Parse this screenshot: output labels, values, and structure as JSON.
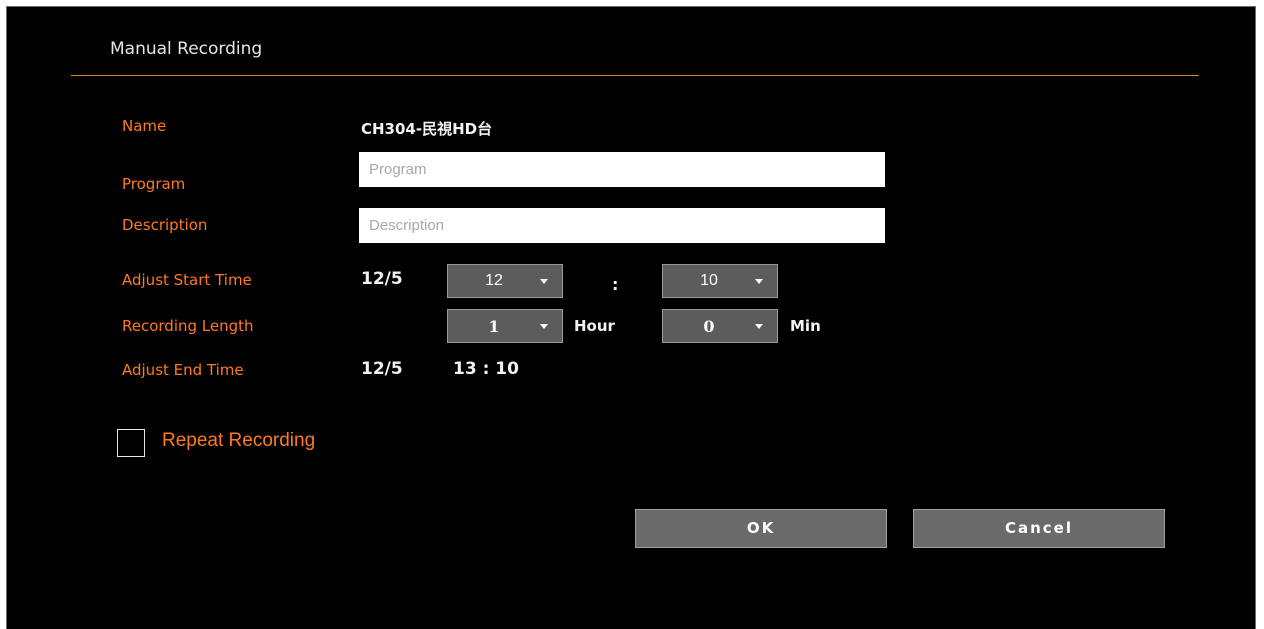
{
  "dialog": {
    "title": "Manual Recording"
  },
  "fields": {
    "name_label": "Name",
    "name_value": "CH304-民視HD台",
    "program_label": "Program",
    "program_placeholder": "Program",
    "program_value": "",
    "description_label": "Description",
    "description_placeholder": "Description",
    "description_value": "",
    "start_label": "Adjust Start Time",
    "start_date": "12/5",
    "start_hour": "12",
    "time_separator": ":",
    "start_minute": "10",
    "length_label": "Recording Length",
    "length_hours": "1",
    "hours_unit": "Hour",
    "length_minutes": "0",
    "minutes_unit": "Min",
    "end_label": "Adjust End Time",
    "end_date": "12/5",
    "end_time": "13 : 10"
  },
  "repeat": {
    "label": "Repeat Recording",
    "checked": false
  },
  "buttons": {
    "ok": "OK",
    "cancel": "Cancel"
  },
  "icons": {
    "dropdown": "caret-down-icon"
  },
  "colors": {
    "label_orange": "#ff7a1a",
    "rule_orange": "#d9862a",
    "background": "#000000",
    "button_gray": "#6a6a6a"
  }
}
